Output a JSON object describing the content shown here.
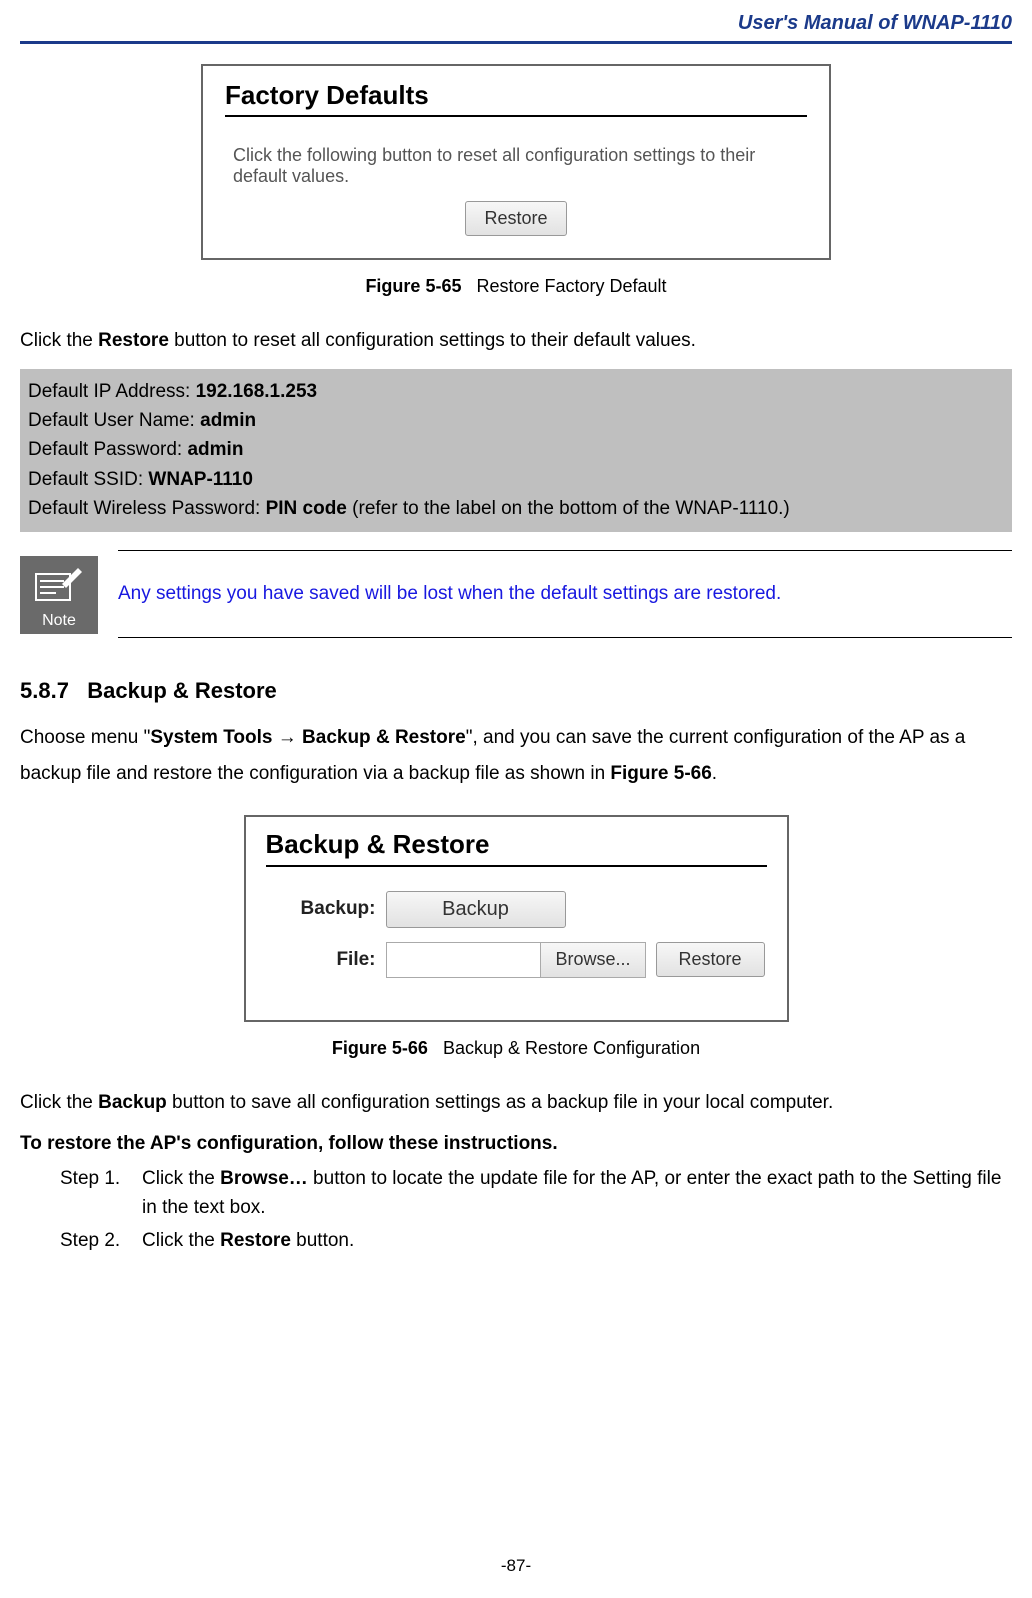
{
  "header": {
    "title": "User's Manual of WNAP-1110"
  },
  "fig1": {
    "panel_title": "Factory Defaults",
    "panel_text": "Click the following button to reset all configuration settings to their default values.",
    "restore_btn": "Restore",
    "caption_bold": "Figure 5-65",
    "caption_rest": "Restore Factory Default"
  },
  "para1": {
    "pre": "Click the ",
    "bold": "Restore",
    "post": " button to reset all configuration settings to their default values."
  },
  "defaults": {
    "ip_label": "Default IP Address: ",
    "ip_value": "192.168.1.253",
    "user_label": "Default User Name: ",
    "user_value": "admin",
    "pass_label": "Default Password: ",
    "pass_value": "admin",
    "ssid_label": "Default SSID: ",
    "ssid_value": "WNAP-1110",
    "wpass_label": "Default Wireless Password: ",
    "wpass_value": "PIN code",
    "wpass_post": " (refer to the label on the bottom of the WNAP-1110.)"
  },
  "note": {
    "icon_label": "Note",
    "text": "Any settings you have saved will be lost when the default settings are restored."
  },
  "section": {
    "number": "5.8.7",
    "title": "Backup & Restore",
    "intro_pre": "Choose menu \"",
    "intro_b1": "System Tools",
    "intro_arrow": " → ",
    "intro_b2": "Backup & Restore",
    "intro_mid": "\", and you can save the current configuration of the AP as a backup file and restore the configuration via a backup file as shown in ",
    "intro_b3": "Figure 5-66",
    "intro_post": "."
  },
  "fig2": {
    "panel_title": "Backup & Restore",
    "backup_label": "Backup:",
    "backup_btn": "Backup",
    "file_label": "File:",
    "browse_btn": "Browse...",
    "restore_btn": "Restore",
    "caption_bold": "Figure 5-66",
    "caption_rest": "Backup & Restore Configuration"
  },
  "para2": {
    "pre": "Click the ",
    "bold": "Backup",
    "post": " button to save all configuration settings as a backup file in your local computer."
  },
  "para3": "To restore the AP's configuration, follow these instructions.",
  "steps": {
    "s1_label": "Step 1.",
    "s1_pre": "Click the ",
    "s1_bold": "Browse…",
    "s1_post": " button to locate the update file for the AP, or enter the exact path to the Setting file in the text box.",
    "s2_label": "Step 2.",
    "s2_pre": "Click the ",
    "s2_bold": "Restore",
    "s2_post": " button."
  },
  "footer": "-87-"
}
